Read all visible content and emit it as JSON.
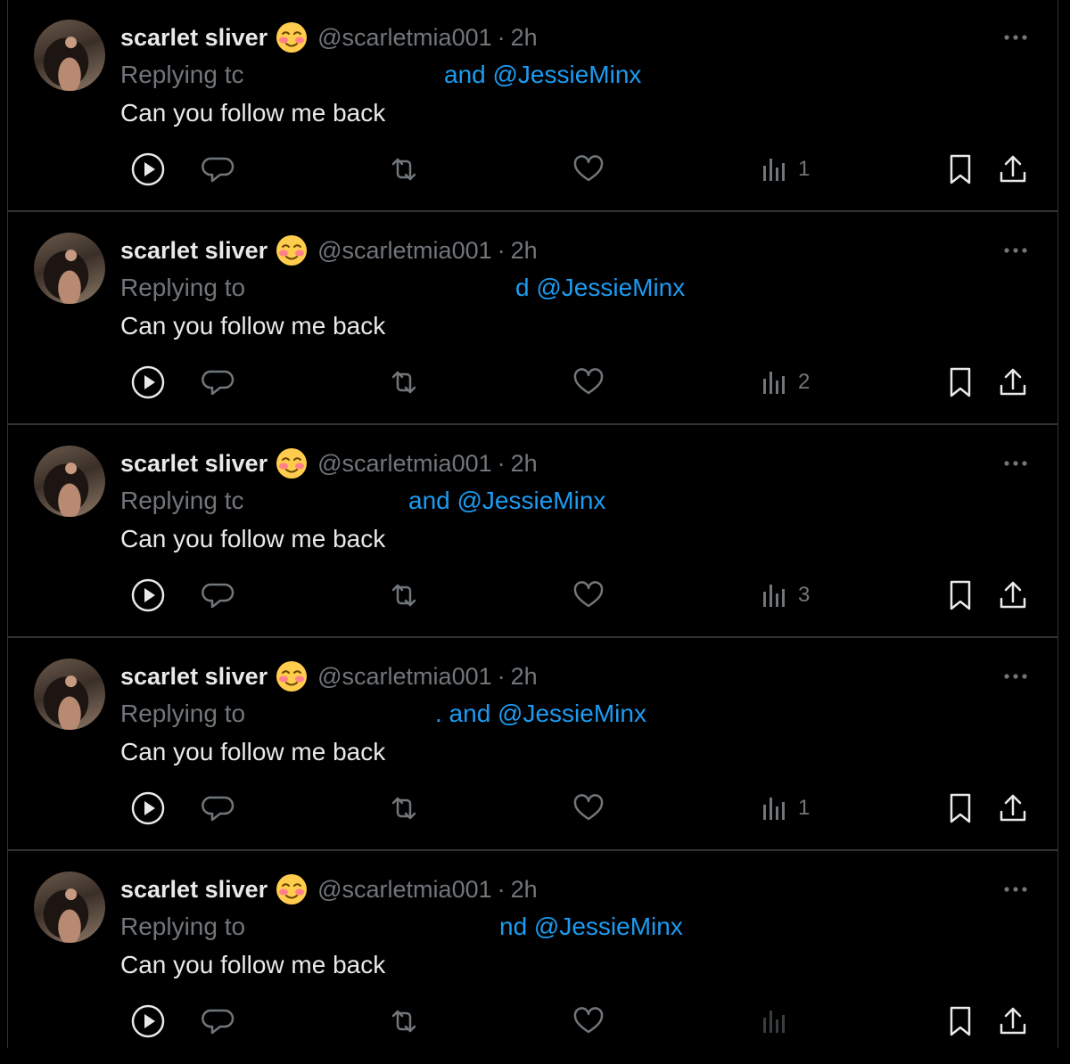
{
  "tweets": [
    {
      "display_name": "scarlet sliver",
      "emoji": "smiling-face-with-blushing-cheeks-emoji",
      "handle": "@scarletmia001",
      "separator": "·",
      "time": "2h",
      "reply_prefix": "Replying tc",
      "reply_tail": "and @JessieMinx",
      "text": "Can you follow me back",
      "views": "1"
    },
    {
      "display_name": "scarlet sliver",
      "emoji": "smiling-face-with-blushing-cheeks-emoji",
      "handle": "@scarletmia001",
      "separator": "·",
      "time": "2h",
      "reply_prefix": "Replying to",
      "reply_tail": "d @JessieMinx",
      "text": "Can you follow me back",
      "views": "2"
    },
    {
      "display_name": "scarlet sliver",
      "emoji": "smiling-face-with-blushing-cheeks-emoji",
      "handle": "@scarletmia001",
      "separator": "·",
      "time": "2h",
      "reply_prefix": "Replying tc",
      "reply_tail": "and @JessieMinx",
      "text": "Can you follow me back",
      "views": "3"
    },
    {
      "display_name": "scarlet sliver",
      "emoji": "smiling-face-with-blushing-cheeks-emoji",
      "handle": "@scarletmia001",
      "separator": "·",
      "time": "2h",
      "reply_prefix": "Replying to",
      "reply_tail": ". and @JessieMinx",
      "text": "Can you follow me back",
      "views": "1"
    },
    {
      "display_name": "scarlet sliver",
      "emoji": "smiling-face-with-blushing-cheeks-emoji",
      "handle": "@scarletmia001",
      "separator": "·",
      "time": "2h",
      "reply_prefix": "Replying to",
      "reply_tail": "nd @JessieMinx",
      "text": "Can you follow me back",
      "views": ""
    }
  ],
  "icons": {
    "play": "play-icon",
    "reply": "reply-icon",
    "retweet": "retweet-icon",
    "like": "heart-icon",
    "views": "views-icon",
    "bookmark": "bookmark-icon",
    "share": "share-icon",
    "more": "more-icon"
  },
  "colors": {
    "background": "#000000",
    "text": "#e7e9ea",
    "muted": "#71767b",
    "link": "#1d9bf0",
    "divider": "#2f3336"
  }
}
